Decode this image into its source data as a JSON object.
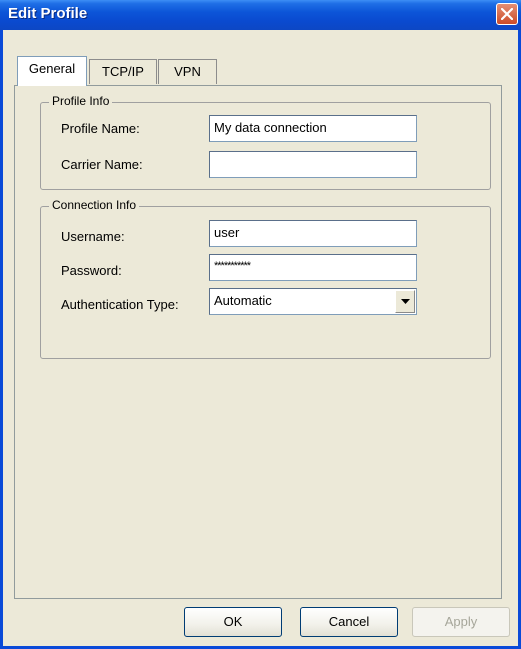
{
  "window": {
    "title": "Edit Profile"
  },
  "tabs": [
    {
      "label": "General"
    },
    {
      "label": "TCP/IP"
    },
    {
      "label": "VPN"
    }
  ],
  "profile_info": {
    "legend": "Profile Info",
    "profile_name_label": "Profile Name:",
    "profile_name_value": "My data connection",
    "carrier_name_label": "Carrier Name:",
    "carrier_name_value": ""
  },
  "connection_info": {
    "legend": "Connection Info",
    "username_label": "Username:",
    "username_value": "user",
    "password_label": "Password:",
    "password_value": "***********",
    "auth_type_label": "Authentication Type:",
    "auth_type_value": "Automatic"
  },
  "buttons": {
    "ok": "OK",
    "cancel": "Cancel",
    "apply": "Apply"
  },
  "colors": {
    "title_bar": "#0a4ad8",
    "close_button": "#cc4b28",
    "dialog_background": "#ece9d8"
  },
  "icons": {
    "close": "close-icon",
    "dropdown": "chevron-down-icon"
  }
}
